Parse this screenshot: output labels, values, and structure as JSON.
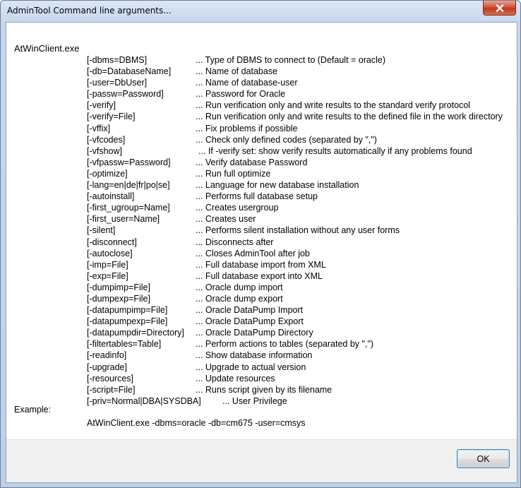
{
  "window": {
    "title": "AdminTool Command line arguments..."
  },
  "heading": "AtWinClient.exe",
  "arguments": [
    {
      "arg": "[-dbms=DBMS]",
      "desc": "... Type of DBMS to connect to (Default = oracle)"
    },
    {
      "arg": "[-db=DatabaseName]",
      "desc": "... Name of database"
    },
    {
      "arg": "[-user=DbUser]",
      "desc": "... Name of database-user"
    },
    {
      "arg": "[-passw=Password]",
      "desc": "... Password for Oracle"
    },
    {
      "arg": "[-verify]",
      "desc": "... Run verification only and write results to the standard verify protocol"
    },
    {
      "arg": "[-verify=File]",
      "desc": "... Run verification only and write results to the defined file in the work directory"
    },
    {
      "arg": "[-vffix]",
      "desc": "... Fix problems if possible"
    },
    {
      "arg": "[-vfcodes]",
      "desc": "... Check only defined codes (separated by \",\")"
    },
    {
      "arg": "[-vfshow]",
      "desc": "... If -verify set: show verify results automatically if any problems found"
    },
    {
      "arg": "[-vfpassw=Password]",
      "desc": "... Verify database Password"
    },
    {
      "arg": "[-optimize]",
      "desc": "... Run full optimize"
    },
    {
      "arg": "[-lang=en|de|fr|po|se]",
      "desc": "... Language for new database installation"
    },
    {
      "arg": "[-autoinstall]",
      "desc": "... Performs full database setup"
    },
    {
      "arg": "[-first_ugroup=Name]",
      "desc": "... Creates usergroup"
    },
    {
      "arg": "[-first_user=Name]",
      "desc": "... Creates user"
    },
    {
      "arg": "[-silent]",
      "desc": "... Performs silent installation without any user forms"
    },
    {
      "arg": "[-disconnect]",
      "desc": "... Disconnects after"
    },
    {
      "arg": "[-autoclose]",
      "desc": "... Closes AdminTool after job"
    },
    {
      "arg": "[-imp=File]",
      "desc": "... Full database import from XML"
    },
    {
      "arg": "[-exp=File]",
      "desc": "... Full database export into XML"
    },
    {
      "arg": "[-dumpimp=File]",
      "desc": "... Oracle dump import"
    },
    {
      "arg": "[-dumpexp=File]",
      "desc": "... Oracle dump export"
    },
    {
      "arg": "[-datapumpimp=File]",
      "desc": "... Oracle DataPump Import"
    },
    {
      "arg": "[-datapumpexp=File]",
      "desc": "... Oracle DataPump Export"
    },
    {
      "arg": "[-datapumpdir=Directory]",
      "desc": "... Oracle DataPump Directory"
    },
    {
      "arg": "[-filtertables=Table]",
      "desc": "... Perform actions to tables (separated by \",\")"
    },
    {
      "arg": "[-readinfo]",
      "desc": "... Show database information"
    },
    {
      "arg": "[-upgrade]",
      "desc": "... Upgrade to actual version"
    },
    {
      "arg": "[-resources]",
      "desc": "... Update resources"
    },
    {
      "arg": "[-script=File]",
      "desc": "... Runs script given by its filename"
    },
    {
      "arg": "[-priv=Normal|DBA|SYSDBA]",
      "desc": "... User Privilege"
    }
  ],
  "example": {
    "label": "Example:",
    "command": "AtWinClient.exe -dbms=oracle -db=cm675 -user=cmsys"
  },
  "buttons": {
    "ok": "OK"
  },
  "icons": {
    "close": "close-icon"
  }
}
